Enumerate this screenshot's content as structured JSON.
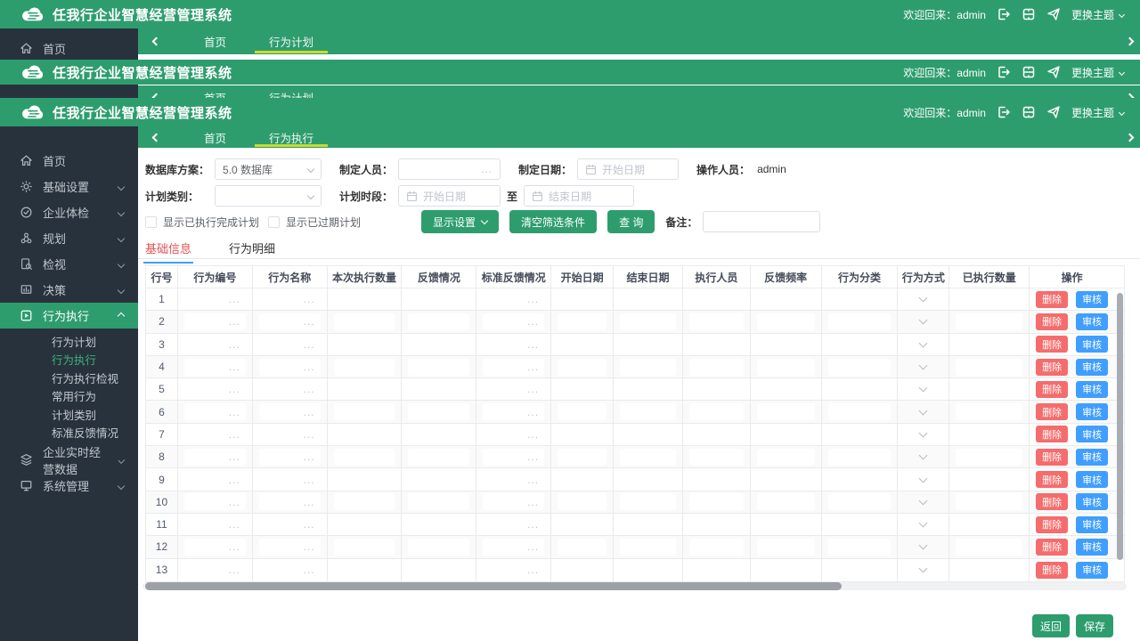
{
  "app": {
    "title": "任我行企业智慧经营管理系统",
    "welcome": "欢迎回来：admin",
    "theme_switch": "更换主题"
  },
  "tabbar_plan": {
    "tabs": [
      "首页",
      "行为计划"
    ]
  },
  "tabbar_exec": {
    "tabs": [
      "首页",
      "行为执行"
    ]
  },
  "sidebar": {
    "items": [
      "首页",
      "基础设置",
      "企业体检",
      "规划",
      "检视",
      "决策",
      "行为执行",
      "企业实时经营数据",
      "系统管理"
    ],
    "submenu": [
      "行为计划",
      "行为执行",
      "行为执行检视",
      "常用行为",
      "计划类别",
      "标准反馈情况"
    ]
  },
  "filters": {
    "db_label": "数据库方案：",
    "db_value": "5.0 数据库",
    "maker_label": "制定人员：",
    "maker_suffix": "...",
    "makedate_label": "制定日期：",
    "date_start_placeholder": "开始日期",
    "date_end_placeholder": "结束日期",
    "operator_label": "操作人员：",
    "operator_value": "admin",
    "plantype_label": "计划类别：",
    "planperiod_label": "计划时段：",
    "to_label": "至",
    "checkbox_done": "显示已执行完成计划",
    "checkbox_expired": "显示已过期计划",
    "btn_display": "显示设置",
    "btn_clear": "清空筛选条件",
    "btn_query": "查 询",
    "remark_label": "备注："
  },
  "content_tabs": {
    "basic": "基础信息",
    "detail": "行为明细"
  },
  "table": {
    "columns": [
      "行号",
      "行为编号",
      "行为名称",
      "本次执行数量",
      "反馈情况",
      "标准反馈情况",
      "开始日期",
      "结束日期",
      "执行人员",
      "反馈频率",
      "行为分类",
      "行为方式",
      "已执行数量",
      "操作"
    ],
    "rows": [
      1,
      2,
      3,
      4,
      5,
      6,
      7,
      8,
      9,
      10,
      11,
      12,
      13
    ],
    "ellipsis": "...",
    "delete_label": "删除",
    "audit_label": "审核"
  },
  "footer": {
    "back": "返回",
    "save": "保存"
  },
  "colors": {
    "green": "#2e9d6e",
    "dark": "#28323c",
    "tab_underline": "#ccd92b",
    "red": "#f56c6c",
    "blue": "#409eff"
  }
}
